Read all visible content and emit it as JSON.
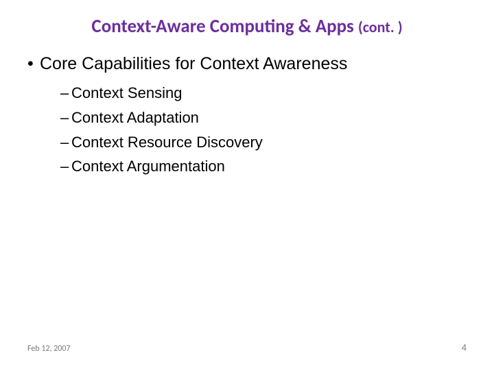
{
  "title": {
    "main": "Context-Aware Computing & Apps ",
    "cont": "(cont. )"
  },
  "bullets": {
    "level1": {
      "marker": "•",
      "text": "Core Capabilities for Context Awareness"
    },
    "sub": [
      {
        "marker": "–",
        "text": "Context Sensing"
      },
      {
        "marker": "–",
        "text": "Context Adaptation"
      },
      {
        "marker": "–",
        "text": "Context Resource Discovery"
      },
      {
        "marker": "–",
        "text": "Context Argumentation"
      }
    ]
  },
  "footer": {
    "date": "Feb 12, 2007",
    "page": "4"
  }
}
